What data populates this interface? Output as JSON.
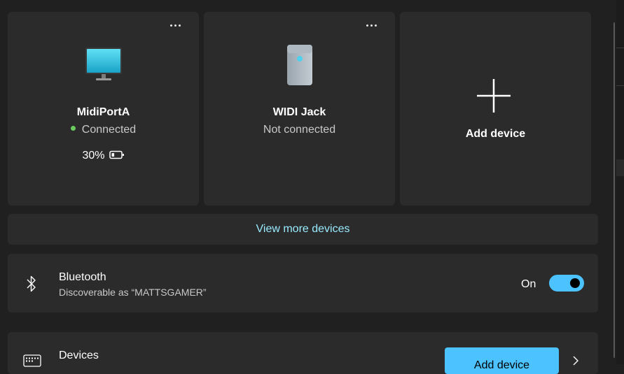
{
  "devices": [
    {
      "name": "MidiPortA",
      "status": "Connected",
      "battery": "30%",
      "battery_level": 0.3,
      "status_color": "#6ccb5f",
      "icon": "monitor-icon"
    },
    {
      "name": "WIDI Jack",
      "status": "Not connected",
      "icon": "tower-icon"
    }
  ],
  "add_card": {
    "label": "Add device",
    "icon": "plus-icon"
  },
  "view_more": "View more devices",
  "bluetooth": {
    "title": "Bluetooth",
    "subtitle": "Discoverable as “MATTSGAMER”",
    "state": "On",
    "enabled": true,
    "icon": "bluetooth-icon"
  },
  "devices_section": {
    "title": "Devices",
    "button": "Add device",
    "icon": "keyboard-icon"
  },
  "colors": {
    "accent": "#4cc2ff",
    "link": "#99ebff",
    "card": "#2b2b2b",
    "background": "#202020"
  }
}
